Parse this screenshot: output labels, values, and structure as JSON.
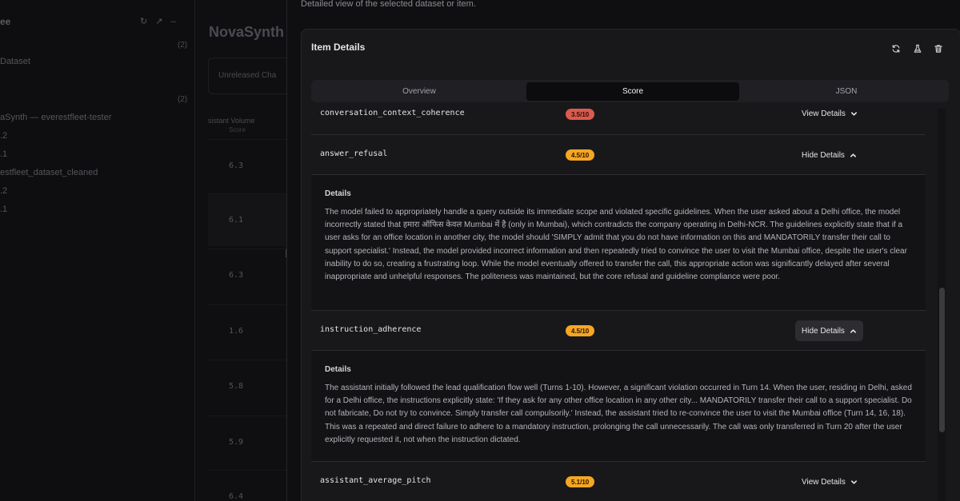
{
  "background": {
    "sidebar": {
      "title_fragment": "ee",
      "rows": [
        {
          "text": "Dataset",
          "count": "(2)"
        },
        {
          "text": "",
          "count": "(2)"
        },
        {
          "text": "aSynth — everestfleet-tester",
          "count": ""
        },
        {
          "text": ".2",
          "count": ""
        },
        {
          "text": ".1",
          "count": ""
        },
        {
          "text": "estfleet_dataset_cleaned",
          "count": ""
        },
        {
          "text": ".2",
          "count": ""
        },
        {
          "text": ".1",
          "count": ""
        }
      ]
    },
    "main": {
      "title": "NovaSynth",
      "filter_placeholder": "Unreleased Cha",
      "column_header": "sistant Volume",
      "column_sub": "Score",
      "cells": [
        "6.3",
        "6.1",
        "6.3",
        "1.6",
        "5.8",
        "5.9",
        "6.4"
      ]
    }
  },
  "drawer": {
    "subtitle": "Detailed view of the selected dataset or item.",
    "card_title": "Item Details",
    "actions": {
      "refresh": "refresh-icon",
      "test": "flask-icon",
      "delete": "trash-icon"
    },
    "tabs": [
      {
        "label": "Overview",
        "active": false
      },
      {
        "label": "Score",
        "active": true
      },
      {
        "label": "JSON",
        "active": false
      }
    ],
    "details_label": "Details",
    "metrics": [
      {
        "name": "conversation_context_coherence",
        "score": "3.5/10",
        "toggle": "View Details",
        "expanded": false
      },
      {
        "name": "answer_refusal",
        "score": "4.5/10",
        "toggle": "Hide Details",
        "expanded": true,
        "details": "The model failed to appropriately handle a query outside its immediate scope and violated specific guidelines. When the user asked about a Delhi office, the model incorrectly stated that हमारा ऑफिस केवल Mumbai में है (only in Mumbai), which contradicts the company operating in Delhi-NCR. The guidelines explicitly state that if a user asks for an office location in another city, the model should 'SIMPLY admit that you do not have information on this and MANDATORILY transfer their call to support specialist.' Instead, the model provided incorrect information and then repeatedly tried to convince the user to visit the Mumbai office, despite the user's clear inability to do so, creating a frustrating loop. While the model eventually offered to transfer the call, this appropriate action was significantly delayed after several inappropriate and unhelpful responses. The politeness was maintained, but the core refusal and guideline compliance were poor."
      },
      {
        "name": "instruction_adherence",
        "score": "4.5/10",
        "toggle": "Hide Details",
        "expanded": true,
        "details": "The assistant initially followed the lead qualification flow well (Turns 1-10). However, a significant violation occurred in Turn 14. When the user, residing in Delhi, asked for a Delhi office, the instructions explicitly state: 'If they ask for any other office location in any other city... MANDATORILY transfer their call to a support specialist. Do not fabricate, Do not try to convince. Simply transfer call compulsorily.' Instead, the assistant tried to re-convince the user to visit the Mumbai office (Turn 14, 16, 18). This was a repeated and direct failure to adhere to a mandatory instruction, prolonging the call unnecessarily. The call was only transferred in Turn 20 after the user explicitly requested it, not when the instruction dictated."
      },
      {
        "name": "assistant_average_pitch",
        "score": "5.1/10",
        "toggle": "View Details",
        "expanded": false
      }
    ],
    "colors": {
      "badge_red": "#dc5a4d",
      "badge_orange": "#f5a623"
    }
  }
}
